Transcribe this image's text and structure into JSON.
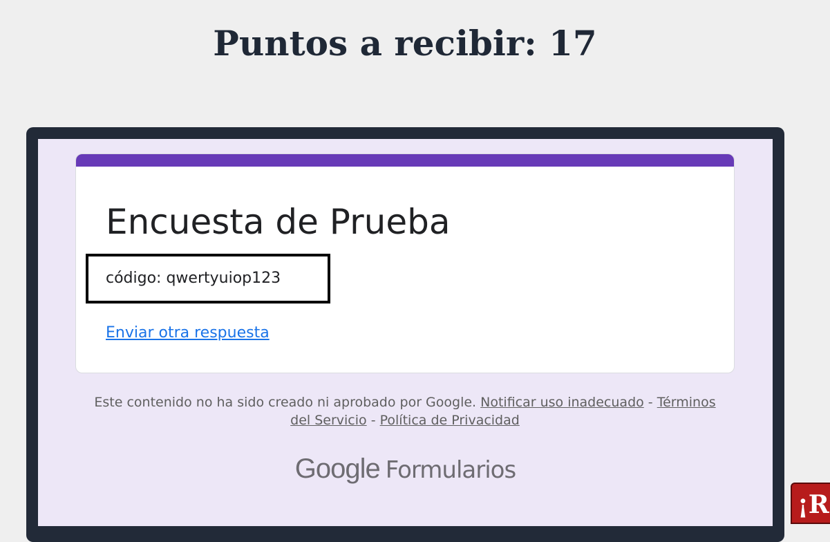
{
  "header": {
    "points_title": "Puntos a recibir: 17"
  },
  "form": {
    "title": "Encuesta de Prueba",
    "code_text": "código: qwertyuiop123",
    "resubmit_link": "Enviar otra respuesta"
  },
  "footer": {
    "disclaimer_text": "Este contenido no ha sido creado ni aprobado por Google.",
    "report_link": "Notificar uso inadecuado",
    "separator": "-",
    "terms_link": "Términos del Servicio",
    "privacy_link": "Política de Privacidad",
    "brand_google": "Google",
    "brand_product": "Formularios"
  },
  "corner_badge": {
    "text": "¡RE"
  },
  "colors": {
    "page_background": "#efefef",
    "frame": "#222a38",
    "form_background": "#ede7f7",
    "form_accent": "#673ab7",
    "link": "#1a73e8",
    "title_text": "#1f2836",
    "badge": "#b71c1c"
  }
}
